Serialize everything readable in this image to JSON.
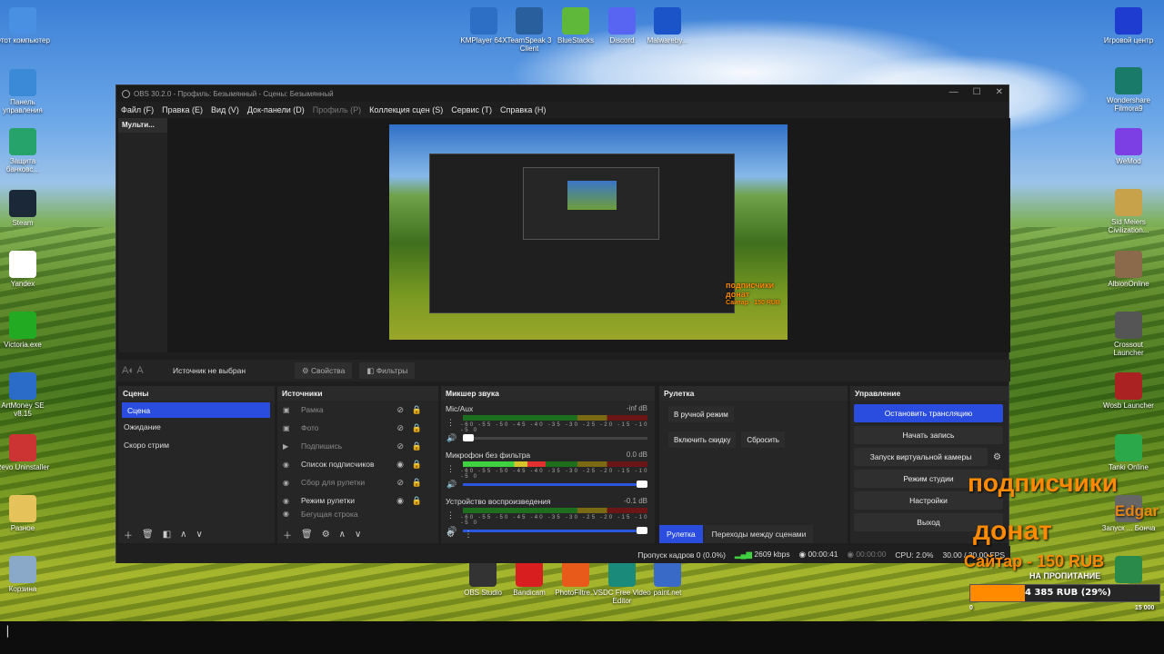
{
  "desktop": {
    "left_icons": [
      {
        "label": "Этот компьютер",
        "icon": "computer-icon",
        "color": "#4a90e2"
      },
      {
        "label": "Панель управления",
        "icon": "control-panel-icon",
        "color": "#3a8ad8"
      },
      {
        "label": "Защита банковс...",
        "icon": "shield-icon",
        "color": "#26a36a"
      },
      {
        "label": "Steam",
        "icon": "steam-icon",
        "color": "#1b2838"
      },
      {
        "label": "Yandex",
        "icon": "yandex-icon",
        "color": "#ffffff"
      },
      {
        "label": "Victoria.exe",
        "icon": "victoria-icon",
        "color": "#22aa22"
      },
      {
        "label": "ArtMoney SE v8.15",
        "icon": "artmoney-icon",
        "color": "#2a6cc8"
      },
      {
        "label": "Revo Uninstaller",
        "icon": "revo-icon",
        "color": "#cc3333"
      },
      {
        "label": "Разное",
        "icon": "folder-icon",
        "color": "#e6c35a"
      },
      {
        "label": "Корзина",
        "icon": "recycle-bin-icon",
        "color": "#8aa8c8"
      }
    ],
    "top_icons": [
      {
        "label": "KMPlayer 64X",
        "icon": "kmplayer-icon",
        "color": "#2d6fc4"
      },
      {
        "label": "TeamSpeak 3 Client",
        "icon": "teamspeak-icon",
        "color": "#2a5f9e"
      },
      {
        "label": "BlueStacks",
        "icon": "bluestacks-icon",
        "color": "#5fb83a"
      },
      {
        "label": "Discord",
        "icon": "discord-icon",
        "color": "#5865f2"
      },
      {
        "label": "Malwareby...",
        "icon": "malwarebytes-icon",
        "color": "#1b54c8"
      }
    ],
    "right_icons": [
      {
        "label": "Игровой центр",
        "icon": "xbox-icon",
        "color": "#1e3ccf"
      },
      {
        "label": "Wondershare Filmora9",
        "icon": "filmora-icon",
        "color": "#1a7a6a"
      },
      {
        "label": "WeMod",
        "icon": "wemod-icon",
        "color": "#7b3fe4"
      },
      {
        "label": "Sid Meiers Civilization...",
        "icon": "civilization-icon",
        "color": "#c8a24a"
      },
      {
        "label": "AlbionOnline",
        "icon": "albion-icon",
        "color": "#8a6a4a"
      },
      {
        "label": "Crossout Launcher",
        "icon": "crossout-icon",
        "color": "#555555"
      },
      {
        "label": "Wosb Launcher",
        "icon": "wosb-icon",
        "color": "#aa2222"
      },
      {
        "label": "Tanki Online",
        "icon": "tanki-icon",
        "color": "#2aa84a"
      },
      {
        "label": "Запуск ... Бонча",
        "icon": "launcher-icon",
        "color": "#666666"
      },
      {
        "label": "",
        "icon": "globe-icon",
        "color": "#2a8a4a"
      }
    ],
    "taskbar_row_icons": [
      {
        "label": "OBS Studio",
        "icon": "obs-icon",
        "color": "#333333"
      },
      {
        "label": "Bandicam",
        "icon": "bandicam-icon",
        "color": "#d81e1e"
      },
      {
        "label": "PhotoFiltre...",
        "icon": "photofiltre-icon",
        "color": "#e85a1a"
      },
      {
        "label": "VSDC Free Video Editor",
        "icon": "vsdc-icon",
        "color": "#1a8a7a"
      },
      {
        "label": "paint.net",
        "icon": "paintnet-icon",
        "color": "#3a6ac8"
      }
    ]
  },
  "obs": {
    "title": "OBS 30.2.0 - Профиль: Безымянный - Сцены: Безымянный",
    "menu": [
      "Файл (F)",
      "Правка (E)",
      "Вид (V)",
      "Док-панели (D)",
      "Профиль (P)",
      "Коллекция сцен (S)",
      "Сервис (T)",
      "Справка (H)"
    ],
    "multiview_tab": "Мульти...",
    "context": {
      "no_source": "Источник не выбран",
      "properties": "Свойства",
      "filters": "Фильтры"
    },
    "scenes": {
      "title": "Сцены",
      "items": [
        "Сцена",
        "Ожидание",
        "Скоро стрим"
      ]
    },
    "sources": {
      "title": "Источники",
      "items": [
        "Рамка",
        "Фото",
        "Подпишись",
        "Список подписчиков",
        "Сбор для рулетки",
        "Режим рулетки",
        "Бегущая строка"
      ]
    },
    "mixer": {
      "title": "Микшер звука",
      "channels": [
        {
          "name": "Mic/Aux",
          "db": "-inf dB",
          "level": 0.0,
          "volume": 0.03
        },
        {
          "name": "Микрофон без фильтра",
          "db": "0.0 dB",
          "level": 0.45,
          "volume": 1.0
        },
        {
          "name": "Устройство воспроизведения",
          "db": "-0.1 dB",
          "level": 0.0,
          "volume": 1.0
        }
      ],
      "ticks": "-60 -55 -50 -45 -40 -35 -30 -25 -20 -15 -10 -5 0"
    },
    "roulette": {
      "title": "Рулетка",
      "manual": "В ручной режим",
      "discount": "Включить скидку",
      "reset": "Сбросить",
      "tabs": [
        "Рулетка",
        "Переходы между сценами"
      ]
    },
    "controls": {
      "title": "Управление",
      "buttons": [
        "Остановить трансляцию",
        "Начать запись",
        "Запуск виртуальной камеры",
        "Режим студии",
        "Настройки",
        "Выход"
      ]
    },
    "status": {
      "dropped": "Пропуск кадров 0 (0.0%)",
      "bitrate": "2609 kbps",
      "stream_time": "00:00:41",
      "rec_time": "00:00:00",
      "cpu": "CPU: 2.0%",
      "fps": "30.00 / 30.00 FPS"
    },
    "preview_overlay": {
      "line1": "подписчики",
      "line2": "донат",
      "line3": "Сайтар - 150 RUB"
    }
  },
  "overlay": {
    "subscribers": "подписчики",
    "donate": "донат",
    "sub_name": "Edgar",
    "sitar": "Сайтар - 150 RUB",
    "goal_label": "НА ПРОПИТАНИЕ",
    "goal_text": "4 385 RUB (29%)",
    "goal_progress": 0.29,
    "goal_min": "0",
    "goal_max": "15 000",
    "accent": "#ff8a00"
  }
}
